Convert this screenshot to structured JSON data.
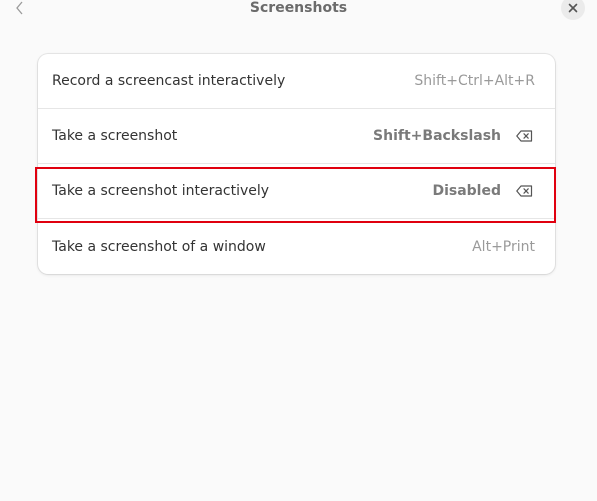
{
  "header": {
    "title": "Screenshots",
    "back_icon": "chevron-left-icon",
    "close_icon": "close-icon"
  },
  "shortcuts": [
    {
      "label": "Record a screencast interactively",
      "accelerator": "Shift+Ctrl+Alt+R",
      "accel_bold": false,
      "has_clear": false
    },
    {
      "label": "Take a screenshot",
      "accelerator": "Shift+Backslash",
      "accel_bold": true,
      "has_clear": true
    },
    {
      "label": "Take a screenshot interactively",
      "accelerator": "Disabled",
      "accel_bold": true,
      "has_clear": true
    },
    {
      "label": "Take a screenshot of a window",
      "accelerator": "Alt+Print",
      "accel_bold": false,
      "has_clear": false
    }
  ],
  "colors": {
    "highlight": "#e0000f",
    "background": "#fafafa",
    "card": "#ffffff"
  }
}
